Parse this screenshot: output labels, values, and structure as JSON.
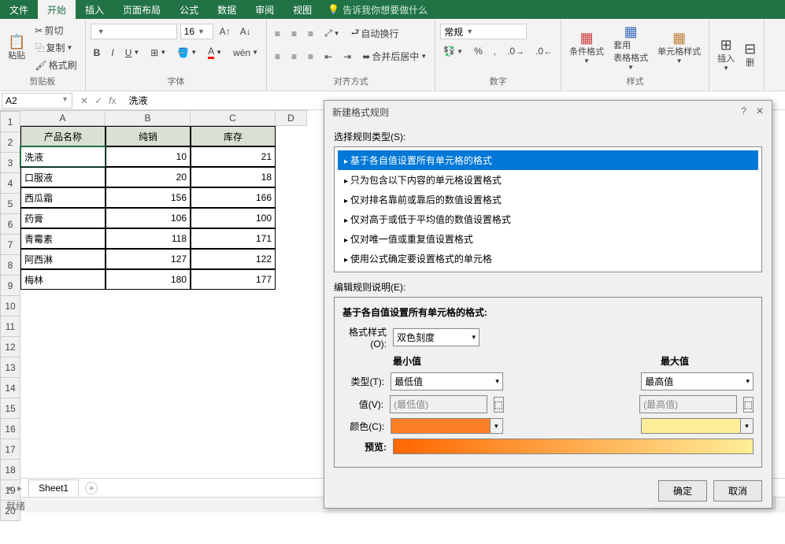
{
  "tabs": {
    "file": "文件",
    "home": "开始",
    "insert": "插入",
    "layout": "页面布局",
    "formula": "公式",
    "data": "数据",
    "review": "审阅",
    "view": "视图",
    "tellme": "告诉我你想要做什么"
  },
  "ribbon": {
    "clipboard": {
      "paste": "粘贴",
      "cut": "剪切",
      "copy": "复制",
      "brush": "格式刷",
      "label": "剪贴板"
    },
    "font": {
      "size": "16",
      "label": "字体"
    },
    "align": {
      "wrap": "自动换行",
      "merge": "合并后居中",
      "label": "对齐方式"
    },
    "number": {
      "general": "常规",
      "label": "数字"
    },
    "styles": {
      "cond": "条件格式",
      "table": "套用\n表格格式",
      "cell": "单元格样式",
      "label": "样式"
    },
    "cells": {
      "insert": "插入",
      "del": "删"
    }
  },
  "namebox": "A2",
  "fx_value": "洗液",
  "columns": [
    "A",
    "B",
    "C",
    "D"
  ],
  "headers": [
    "产品名称",
    "纯销",
    "库存"
  ],
  "data": [
    [
      "洗液",
      "10",
      "21"
    ],
    [
      "口服液",
      "20",
      "18"
    ],
    [
      "西瓜霜",
      "156",
      "166"
    ],
    [
      "药膏",
      "106",
      "100"
    ],
    [
      "青霉素",
      "118",
      "171"
    ],
    [
      "阿西淋",
      "127",
      "122"
    ],
    [
      "梅林",
      "180",
      "177"
    ]
  ],
  "sheet_tab": "Sheet1",
  "status": "就绪",
  "dialog": {
    "title": "新建格式规则",
    "select_label": "选择规则类型(S):",
    "rules": [
      "基于各自值设置所有单元格的格式",
      "只为包含以下内容的单元格设置格式",
      "仅对排名靠前或靠后的数值设置格式",
      "仅对高于或低于平均值的数值设置格式",
      "仅对唯一值或重复值设置格式",
      "使用公式确定要设置格式的单元格"
    ],
    "edit_label": "编辑规则说明(E):",
    "edit_title": "基于各自值设置所有单元格的格式:",
    "format_style": "格式样式(O):",
    "format_style_val": "双色刻度",
    "min_label": "最小值",
    "max_label": "最大值",
    "type_label": "类型(T):",
    "type_min": "最低值",
    "type_max": "最高值",
    "value_label": "值(V):",
    "value_min_ph": "(最低值)",
    "value_max_ph": "(最高值)",
    "color_label": "颜色(C):",
    "preview_label": "预览:",
    "ok": "确定",
    "cancel": "取消",
    "colors": {
      "min": "#ff7f27",
      "max": "#ffee99"
    }
  }
}
